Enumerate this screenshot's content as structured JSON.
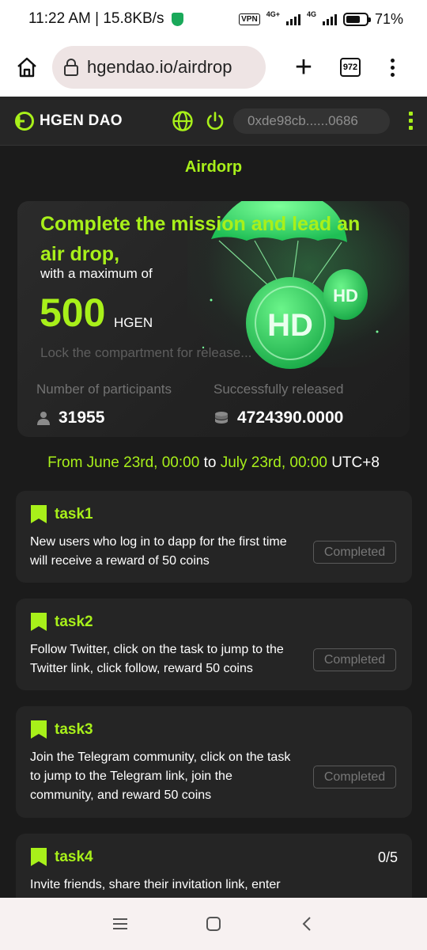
{
  "status_bar": {
    "time_speed": "11:22 AM | 15.8KB/s",
    "vpn": "VPN",
    "network_1": "4G+",
    "network_2": "4G",
    "battery_percent": "71%",
    "battery_level": 0.71
  },
  "browser": {
    "url": "hgendao.io/airdrop",
    "tab_count": "972"
  },
  "header": {
    "logo_text": "HGEN DAO",
    "wallet_address": "0xde98cb......0686",
    "accent_color": "#a8f01a"
  },
  "page": {
    "title": "Airdorp"
  },
  "hero": {
    "headline": "Complete the mission and lead an air drop,",
    "subline": "with a maximum of",
    "amount": "500",
    "unit": "HGEN",
    "lock_text": "Lock the compartment for release...",
    "participants_label": "Number of participants",
    "participants_value": "31955",
    "released_label": "Successfully released",
    "released_value": "4724390.0000"
  },
  "schedule": {
    "from_word": "From",
    "start": "June 23rd, 00:00",
    "to_word": "to",
    "end": "July 23rd, 00:00",
    "timezone": "UTC+8"
  },
  "tasks": [
    {
      "title": "task1",
      "description": "New users who log in to dapp for the first time will receive a reward of 50 coins",
      "status": "Completed"
    },
    {
      "title": "task2",
      "description": "Follow Twitter, click on the task to jump to the Twitter link, click follow, reward 50 coins",
      "status": "Completed"
    },
    {
      "title": "task3",
      "description": "Join the Telegram community, click on the task to jump to the Telegram link, join the community, and reward 50 coins",
      "status": "Completed"
    },
    {
      "title": "task4",
      "description": "Invite friends, share their invitation link, enter",
      "progress": "0/5"
    }
  ]
}
